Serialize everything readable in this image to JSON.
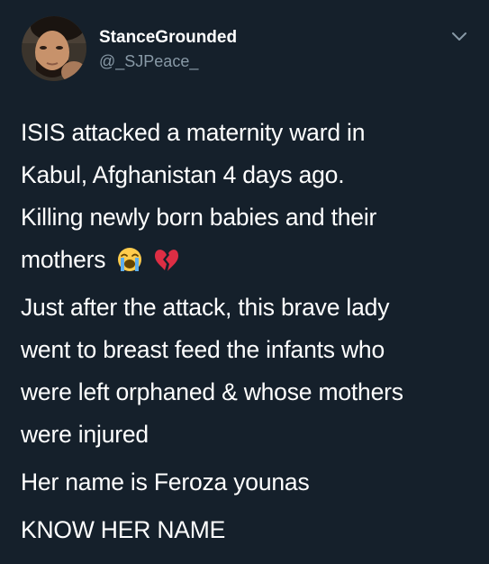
{
  "tweet": {
    "author": {
      "display_name": "StanceGrounded",
      "handle": "@_SJPeace_"
    },
    "menu_icon": "chevron-down-icon",
    "paragraphs": [
      {
        "lines": [
          "ISIS attacked a maternity ward in",
          "Kabul, Afghanistan 4 days ago.",
          "Killing newly born babies and their",
          "mothers"
        ],
        "emojis": [
          "loudly-crying-face-emoji",
          "broken-heart-emoji"
        ]
      },
      {
        "lines": [
          "Just after the attack, this brave lady",
          "went to breast feed the infants who",
          "were left orphaned & whose mothers",
          "were injured"
        ]
      },
      {
        "lines": [
          "Her name is Feroza younas"
        ]
      },
      {
        "lines": [
          "KNOW HER NAME"
        ]
      }
    ]
  },
  "colors": {
    "background": "#15202b",
    "text": "#ffffff",
    "secondary_text": "#8899a6"
  }
}
